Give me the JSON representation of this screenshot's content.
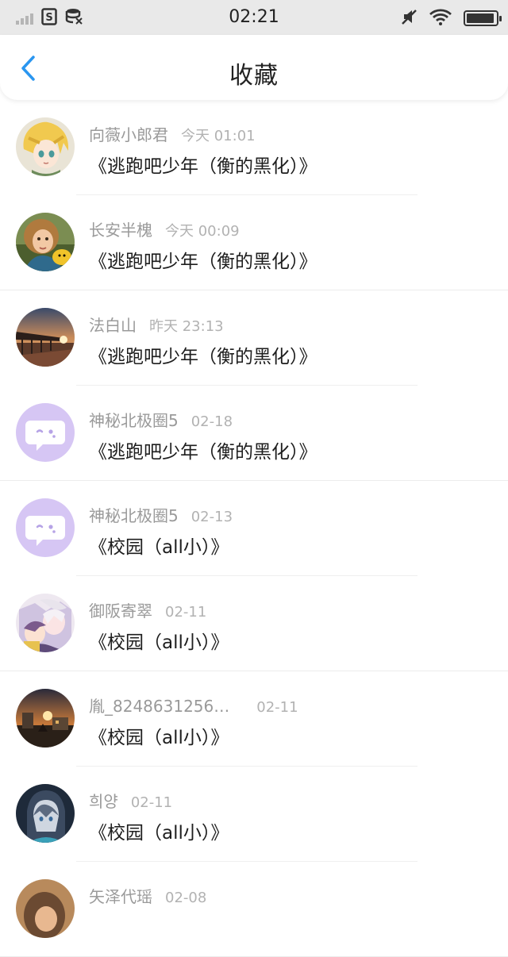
{
  "status_bar": {
    "time": "02:21",
    "icons": [
      "signal-icon",
      "sim-icon",
      "data-icon",
      "mute-icon",
      "wifi-icon",
      "battery-icon"
    ],
    "battery_level": 0.95
  },
  "header": {
    "title": "收藏",
    "back_icon": "chevron-left-icon",
    "accent": "#2a96f0"
  },
  "favorites": [
    {
      "user": "向薇小郎君",
      "time": "今天 01:01",
      "title": "《逃跑吧少年（衡的黑化）》",
      "avatar": "anime-blond"
    },
    {
      "user": "长安半槐",
      "time": "今天 00:09",
      "title": "《逃跑吧少年（衡的黑化）》",
      "avatar": "child-photo"
    },
    {
      "user": "法白山",
      "time": "昨天 23:13",
      "title": "《逃跑吧少年（衡的黑化）》",
      "avatar": "sunset-pier"
    },
    {
      "user": "神秘北极圈5",
      "time": "02-18",
      "title": "《逃跑吧少年（衡的黑化）》",
      "avatar": "default-chat"
    },
    {
      "user": "神秘北极圈5",
      "time": "02-13",
      "title": "《校园（all小）》",
      "avatar": "default-chat"
    },
    {
      "user": "御阪寄翠",
      "time": "02-11",
      "title": "《校园（all小）》",
      "avatar": "anime-pair"
    },
    {
      "user": "胤_8248631256…",
      "time": "02-11",
      "title": "《校园（all小）》",
      "avatar": "dusk-scene"
    },
    {
      "user": "희양",
      "time": "02-11",
      "title": "《校园（all小）》",
      "avatar": "hooded-anime"
    },
    {
      "user": "矢泽代瑶",
      "time": "02-08",
      "title": "",
      "avatar": "warm-photo"
    }
  ]
}
